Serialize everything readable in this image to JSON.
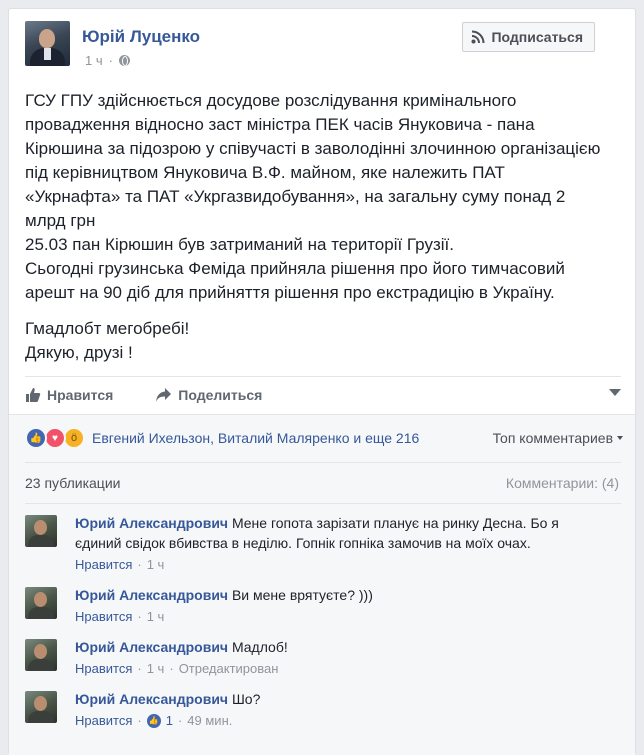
{
  "post": {
    "author": "Юрій Луценко",
    "time": "1 ч",
    "subscribe_label": "Подписаться",
    "paragraphs": [
      [
        "ГСУ ГПУ здійснюється досудове розслідування кримінального",
        "провадження відносно заст міністра ПЕК часів Януковича - пана",
        "Кірюшина за підозрою у співучасті в заволодінні злочинною організацією",
        "під керівництвом Януковича В.Ф. майном, яке належить ПАТ",
        "«Укрнафта» та ПАТ «Укргазвидобування», на загальну суму понад 2",
        "млрд грн",
        "25.03 пан Кірюшин був затриманий на території Грузії.",
        "Сьогодні грузинська Феміда прийняла рішення про його тимчасовий",
        "арешт на 90 діб для прийняття рішення про екстрадицію в Україну."
      ],
      [
        "Гмадлобт мегобребі!",
        "Дякую, друзі !"
      ]
    ],
    "like_label": "Нравится",
    "share_label": "Поделиться"
  },
  "feedback": {
    "reactors_text": "Евгений Ихельзон, Виталий Маляренко и еще 216",
    "top_comments": "Топ комментариев",
    "shares": "23 публикации",
    "comments_count": "Комментарии: (4)"
  },
  "comments": [
    {
      "author": "Юрий Александрович",
      "text": "Мене гопота зарізати планує на ринку Десна. Бо я",
      "text2": "єдиний свідок вбивства в неділю. Гопнік гопніка замочив на моїх очах.",
      "like": "Нравится",
      "time": "1 ч",
      "edited": "",
      "likes": ""
    },
    {
      "author": "Юрий Александрович",
      "text": "Ви мене врятуєте? )))",
      "text2": "",
      "like": "Нравится",
      "time": "1 ч",
      "edited": "",
      "likes": ""
    },
    {
      "author": "Юрий Александрович",
      "text": "Мадлоб!",
      "text2": "",
      "like": "Нравится",
      "time": "1 ч",
      "edited": "Отредактирован",
      "likes": ""
    },
    {
      "author": "Юрий Александрович",
      "text": "Шо?",
      "text2": "",
      "like": "Нравится",
      "time": "49 мин.",
      "edited": "",
      "likes": "1"
    }
  ]
}
